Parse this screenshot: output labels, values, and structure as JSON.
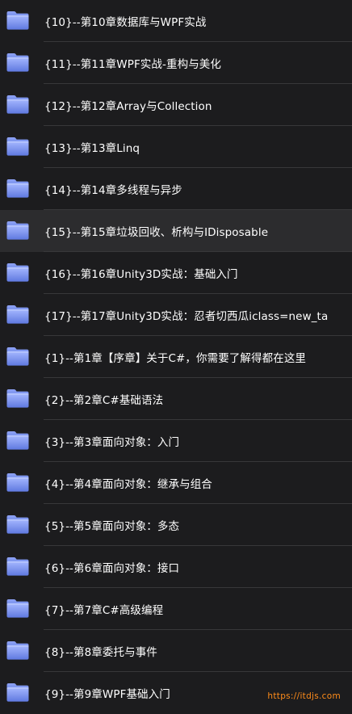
{
  "folders": [
    {
      "label": "{10}--第10章数据库与WPF实战",
      "icon": "folder-icon"
    },
    {
      "label": "{11}--第11章WPF实战-重构与美化",
      "icon": "folder-icon"
    },
    {
      "label": "{12}--第12章Array与Collection",
      "icon": "folder-icon"
    },
    {
      "label": "{13}--第13章Linq",
      "icon": "folder-icon"
    },
    {
      "label": "{14}--第14章多线程与异步",
      "icon": "folder-icon"
    },
    {
      "label": "{15}--第15章垃圾回收、析构与IDisposable",
      "icon": "folder-icon",
      "selected": true
    },
    {
      "label": "{16}--第16章Unity3D实战：基础入门",
      "icon": "folder-icon"
    },
    {
      "label": "{17}--第17章Unity3D实战：忍者切西瓜iclass=new_ta",
      "icon": "folder-icon"
    },
    {
      "label": "{1}--第1章【序章】关于C#，你需要了解得都在这里",
      "icon": "folder-icon"
    },
    {
      "label": "{2}--第2章C#基础语法",
      "icon": "folder-icon"
    },
    {
      "label": "{3}--第3章面向对象：入门",
      "icon": "folder-icon"
    },
    {
      "label": "{4}--第4章面向对象：继承与组合",
      "icon": "folder-icon"
    },
    {
      "label": "{5}--第5章面向对象：多态",
      "icon": "folder-icon"
    },
    {
      "label": "{6}--第6章面向对象：接口",
      "icon": "folder-icon"
    },
    {
      "label": "{7}--第7章C#高级编程",
      "icon": "folder-icon"
    },
    {
      "label": "{8}--第8章委托与事件",
      "icon": "folder-icon"
    },
    {
      "label": "{9}--第9章WPF基础入门",
      "icon": "folder-icon"
    }
  ],
  "watermark": "https://itdjs.com",
  "colors": {
    "background": "#1c1c1e",
    "selected_row": "#2c2c2e",
    "folder_top": "#a6b8ff",
    "folder_bottom": "#5f79e0",
    "watermark": "#ff8c1a"
  }
}
